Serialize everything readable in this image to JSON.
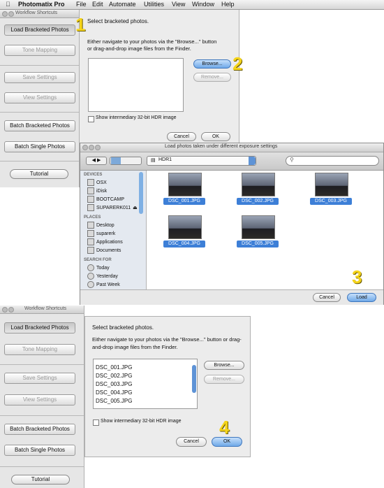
{
  "menubar": {
    "app_name": "Photomatix Pro",
    "items": [
      "File",
      "Edit",
      "Automate",
      "Utilities",
      "View",
      "Window",
      "Help"
    ]
  },
  "panel_top": {
    "title": "Workflow Shortcuts",
    "buttons": [
      "Load Bracketed Photos",
      "Tone Mapping",
      "Save Settings",
      "View Settings",
      "Batch Bracketed Photos",
      "Batch Single Photos",
      "Tutorial"
    ]
  },
  "dialog_top": {
    "heading": "Select bracketed photos.",
    "instructions": "Either navigate to your photos via the \"Browse...\" button or drag-and-drop image files from the Finder.",
    "browse_label": "Browse...",
    "remove_label": "Remove...",
    "checkbox_label": "Show intermediary 32-bit HDR image",
    "cancel_label": "Cancel",
    "ok_label": "OK"
  },
  "finder": {
    "title": "Load photos taken under different exposure settings",
    "folder": "HDR1",
    "sections": {
      "devices_label": "DEVICES",
      "places_label": "PLACES",
      "search_label": "SEARCH FOR"
    },
    "devices": [
      "OSX",
      "iDisk",
      "BOOTCAMP",
      "SUPARERK011"
    ],
    "places": [
      "Desktop",
      "suparerk",
      "Applications",
      "Documents"
    ],
    "search": [
      "Today",
      "Yesterday",
      "Past Week"
    ],
    "files": [
      "DSC_001.JPG",
      "DSC_002.JPG",
      "DSC_003.JPG",
      "DSC_004.JPG",
      "DSC_005.JPG"
    ],
    "cancel_label": "Cancel",
    "load_label": "Load"
  },
  "panel_bottom": {
    "title": "Workflow Shortcuts",
    "buttons": [
      "Load Bracketed Photos",
      "Tone Mapping",
      "Save Settings",
      "View Settings",
      "Batch Bracketed Photos",
      "Batch Single Photos",
      "Tutorial"
    ]
  },
  "dialog_bottom": {
    "heading": "Select bracketed photos.",
    "instructions": "Either navigate to your photos via the \"Browse...\" button or drag-and-drop image files from the Finder.",
    "files": [
      "DSC_001.JPG",
      "DSC_002.JPG",
      "DSC_003.JPG",
      "DSC_004.JPG",
      "DSC_005.JPG"
    ],
    "browse_label": "Browse...",
    "remove_label": "Remove...",
    "checkbox_label": "Show intermediary 32-bit HDR image",
    "cancel_label": "Cancel",
    "ok_label": "OK"
  },
  "steps": [
    "1",
    "2",
    "3",
    "4"
  ],
  "colors": {
    "accent": "#3d7fd7",
    "step_number": "#f5d41a"
  }
}
